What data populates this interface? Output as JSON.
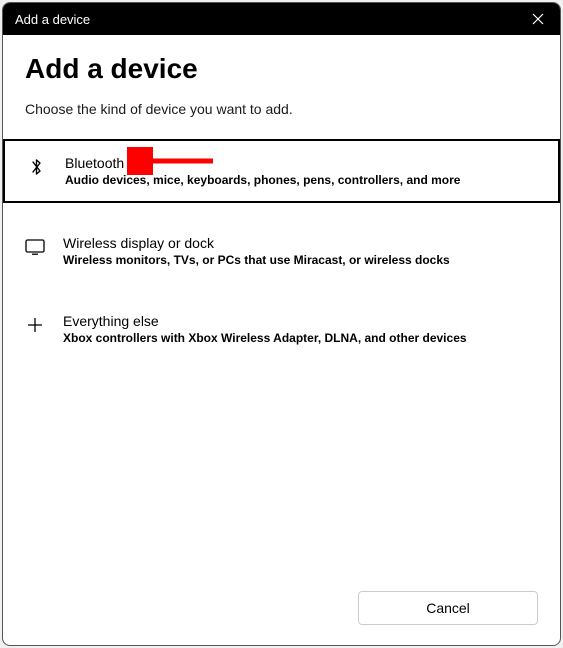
{
  "titlebar": {
    "title": "Add a device"
  },
  "main": {
    "heading": "Add a device",
    "subheading": "Choose the kind of device you want to add."
  },
  "options": [
    {
      "icon": "bluetooth-icon",
      "title": "Bluetooth",
      "desc": "Audio devices, mice, keyboards, phones, pens, controllers, and more",
      "selected": true
    },
    {
      "icon": "display-icon",
      "title": "Wireless display or dock",
      "desc": "Wireless monitors, TVs, or PCs that use Miracast, or wireless docks",
      "selected": false
    },
    {
      "icon": "plus-icon",
      "title": "Everything else",
      "desc": "Xbox controllers with Xbox Wireless Adapter, DLNA, and other devices",
      "selected": false
    }
  ],
  "footer": {
    "cancel_label": "Cancel"
  },
  "annotation": {
    "arrow_color": "#ff0000"
  }
}
